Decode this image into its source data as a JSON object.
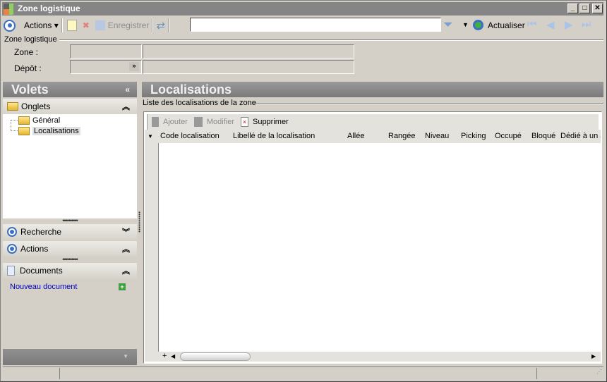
{
  "window": {
    "title": "Zone logistique"
  },
  "toolbar": {
    "actions_label": "Actions",
    "save_label": "Enregistrer",
    "search_value": "",
    "refresh_label": "Actualiser"
  },
  "form": {
    "group_label": "Zone logistique",
    "zone_label": "Zone :",
    "zone_code": "",
    "zone_name": "",
    "depot_label": "Dépôt :",
    "depot_code": "",
    "depot_name": ""
  },
  "left_panel": {
    "title": "Volets",
    "sections": {
      "tabs": "Onglets",
      "search": "Recherche",
      "actions": "Actions",
      "documents": "Documents"
    },
    "tree": [
      "Général",
      "Localisations"
    ],
    "new_document": "Nouveau document"
  },
  "main": {
    "title": "Localisations",
    "group_label": "Liste des localisations de la zone",
    "grid_toolbar": {
      "add": "Ajouter",
      "edit": "Modifier",
      "delete": "Supprimer"
    },
    "columns": [
      "Code localisation",
      "Libellé de la localisation",
      "Allée",
      "Rangée",
      "Niveau",
      "Picking",
      "Occupé",
      "Bloqué",
      "Dédié à un a"
    ]
  },
  "colors": {
    "titlebar": "#858585",
    "panel_header": "#8a8a8a",
    "link": "#0000c0"
  }
}
